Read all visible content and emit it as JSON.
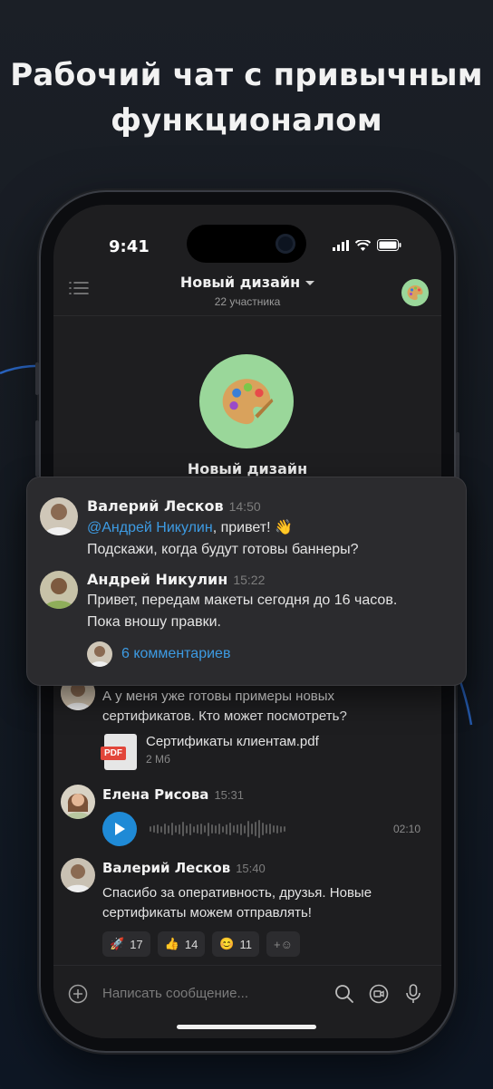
{
  "headline": {
    "line1": "Рабочий чат с привычным",
    "line2": "функционалом"
  },
  "status_bar": {
    "time": "9:41"
  },
  "chat_header": {
    "title": "Новый дизайн",
    "subtitle": "22 участника",
    "avatar_icon": "palette-icon"
  },
  "group": {
    "name": "Новый дизайн",
    "avatar_icon": "palette-icon"
  },
  "highlight_card": {
    "message1": {
      "author": "Валерий Лесков",
      "time": "14:50",
      "mention": "@Андрей Никулин",
      "line1_rest": ", привет! 👋",
      "line2": "Подскажи, когда будут готовы баннеры?"
    },
    "message2": {
      "author": "Андрей Никулин",
      "time": "15:22",
      "line1": "Привет, передам макеты сегодня до 16 часов.",
      "line2": "Пока вношу правки."
    },
    "comments_label": "6 комментариев"
  },
  "messages": {
    "m3": {
      "line1": "А у меня уже готовы примеры новых",
      "line2": "сертификатов. Кто может посмотреть?"
    },
    "file": {
      "name": "Сертификаты клиентам.pdf",
      "size": "2 Мб",
      "badge": "PDF"
    },
    "voice": {
      "author": "Елена Рисова",
      "time": "15:31",
      "duration": "02:10"
    },
    "m5": {
      "author": "Валерий Лесков",
      "time": "15:40",
      "line1": "Спасибо за оперативность, друзья. Новые",
      "line2": "сертификаты можем отправлять!"
    },
    "reactions": [
      {
        "emoji": "🚀",
        "count": "17"
      },
      {
        "emoji": "👍",
        "count": "14"
      },
      {
        "emoji": "😊",
        "count": "11"
      }
    ],
    "add_reaction": "+☺"
  },
  "composer": {
    "placeholder": "Написать сообщение..."
  },
  "colors": {
    "accent": "#3d9be3",
    "play": "#1f8ad6",
    "avatar_bg": "#9ad79a",
    "pdf": "#e2463a"
  }
}
